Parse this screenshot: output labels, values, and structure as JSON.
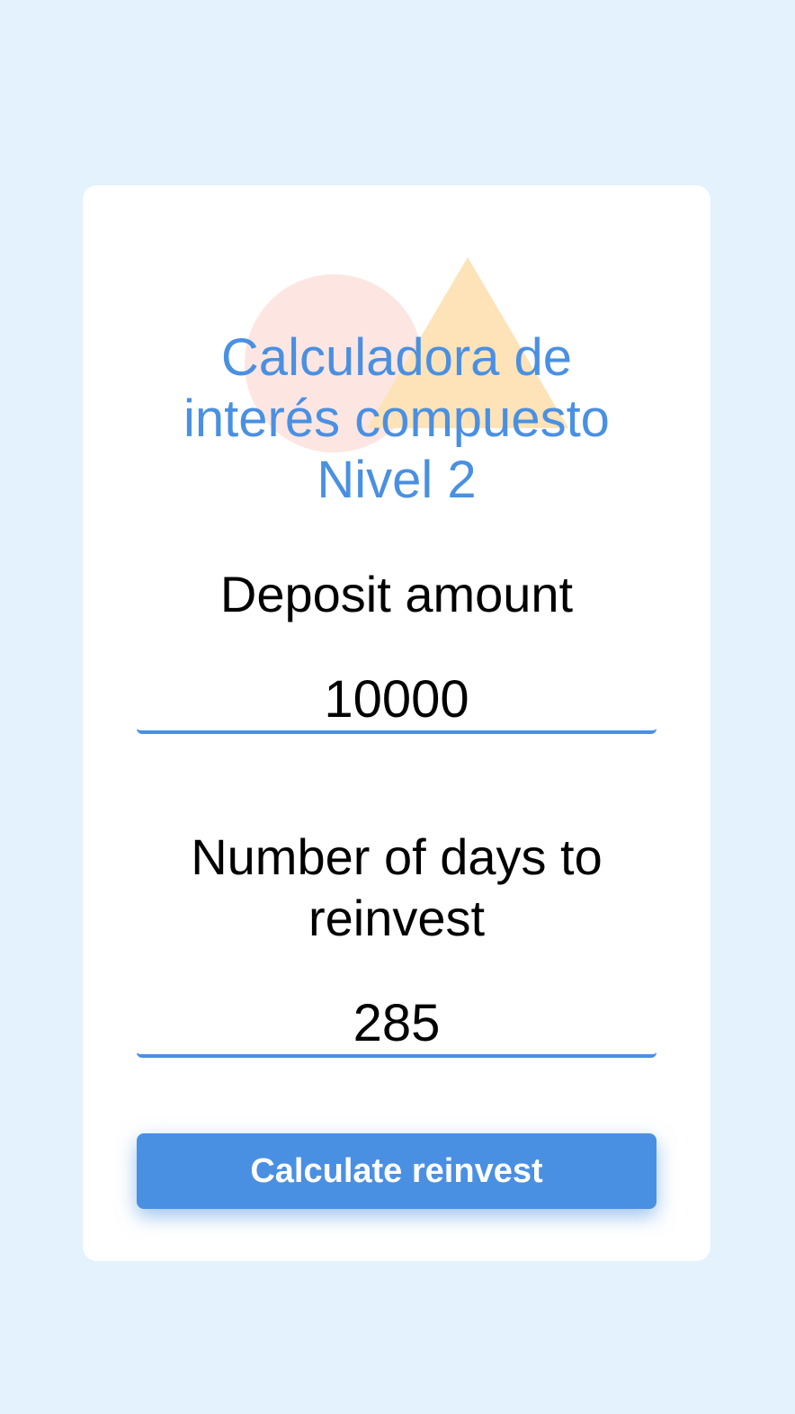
{
  "title": {
    "line1": "Calculadora de",
    "line2": "interés compuesto",
    "line3": "Nivel 2"
  },
  "deposit": {
    "label": "Deposit amount",
    "value": "10000"
  },
  "days": {
    "label_line1": "Number of days to",
    "label_line2": "reinvest",
    "value": "285"
  },
  "button": {
    "label": "Calculate reinvest"
  },
  "colors": {
    "background": "#e3f2fc",
    "accent": "#4a90e2",
    "decor_circle": "#fde6e2",
    "decor_triangle": "#fde3b7"
  }
}
